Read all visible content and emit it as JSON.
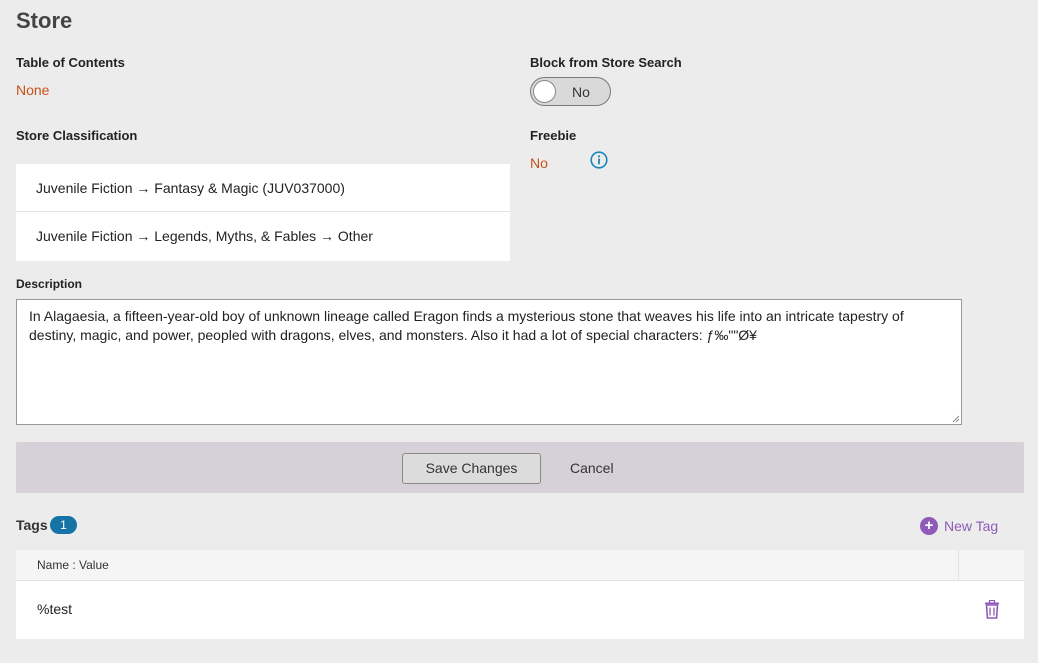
{
  "page": {
    "title": "Store"
  },
  "toc": {
    "label": "Table of Contents",
    "value": "None"
  },
  "block_search": {
    "label": "Block from Store Search",
    "toggle_text": "No"
  },
  "classification": {
    "label": "Store Classification",
    "items": [
      "Juvenile Fiction → Fantasy & Magic (JUV037000)",
      "Juvenile Fiction → Legends, Myths, & Fables → Other"
    ]
  },
  "freebie": {
    "label": "Freebie",
    "value": "No",
    "icon": "info-icon"
  },
  "description": {
    "label": "Description",
    "value": "In Alagaesia, a fifteen-year-old boy of unknown lineage called Eragon finds a mysterious stone that weaves his life into an intricate tapestry of destiny, magic, and power, peopled with dragons, elves, and monsters. Also it had a lot of special characters: ƒ‰\"\"Ø¥"
  },
  "actions": {
    "save_label": "Save Changes",
    "cancel_label": "Cancel"
  },
  "tags": {
    "label": "Tags",
    "count": "1",
    "new_tag_label": "New Tag",
    "column_header": "Name : Value",
    "rows": [
      {
        "value": "%test"
      }
    ]
  },
  "colors": {
    "accent_orange": "#c8501a",
    "badge_blue": "#1673a6",
    "purple": "#8e5cb8",
    "info_blue": "#1a86b8"
  }
}
